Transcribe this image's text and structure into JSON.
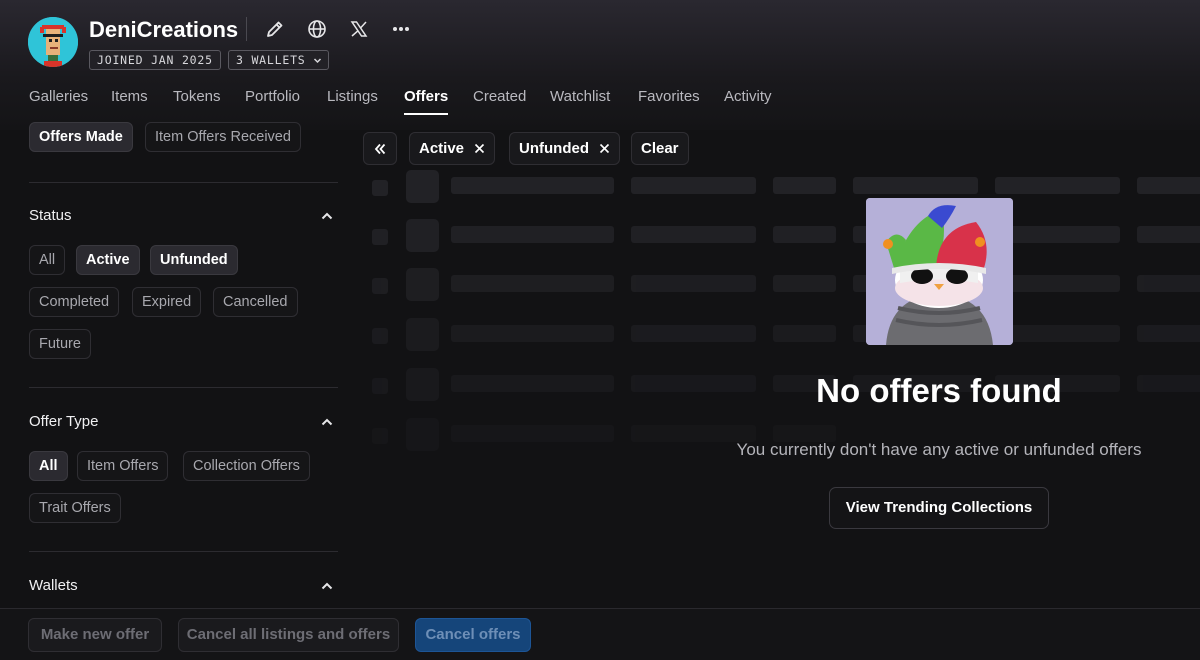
{
  "profile": {
    "username": "DeniCreations",
    "joined": "JOINED JAN 2025",
    "wallets": "3 WALLETS",
    "icons": [
      "pencil-icon",
      "globe-icon",
      "x-logo-icon",
      "more-icon"
    ]
  },
  "tabs": [
    {
      "label": "Galleries"
    },
    {
      "label": "Items"
    },
    {
      "label": "Tokens"
    },
    {
      "label": "Portfolio"
    },
    {
      "label": "Listings"
    },
    {
      "label": "Offers",
      "active": true
    },
    {
      "label": "Created"
    },
    {
      "label": "Watchlist"
    },
    {
      "label": "Favorites"
    },
    {
      "label": "Activity"
    }
  ],
  "sidebar": {
    "direction": {
      "made": "Offers Made",
      "received": "Item Offers Received",
      "selected": "Offers Made"
    },
    "status": {
      "title": "Status",
      "options": [
        "All",
        "Active",
        "Unfunded",
        "Completed",
        "Expired",
        "Cancelled",
        "Future"
      ],
      "selected": [
        "Active",
        "Unfunded"
      ]
    },
    "offer_type": {
      "title": "Offer Type",
      "options": [
        "All",
        "Item Offers",
        "Collection Offers",
        "Trait Offers"
      ],
      "selected": [
        "All"
      ]
    },
    "wallets": {
      "title": "Wallets"
    }
  },
  "filters": {
    "active_chips": [
      "Active",
      "Unfunded"
    ],
    "clear_label": "Clear"
  },
  "empty_state": {
    "title": "No offers found",
    "subtitle": "You currently don't have any active or unfunded offers",
    "cta": "View Trending Collections"
  },
  "bottom_bar": {
    "make_offer": "Make new offer",
    "cancel_all": "Cancel all listings and offers",
    "cancel_offers": "Cancel offers"
  },
  "colors": {
    "background": "#121214",
    "accent_blue": "#15457a",
    "avatar_bg": "#2fc4d8"
  }
}
